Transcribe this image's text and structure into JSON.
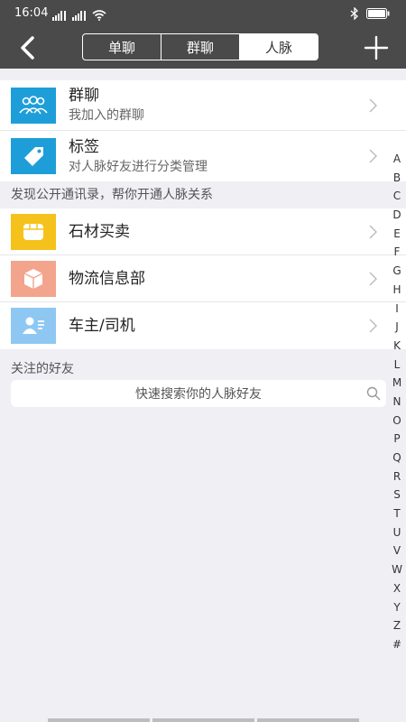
{
  "status_bar": {
    "time": "16:04",
    "signal_1": "4G",
    "signal_2": "4G"
  },
  "nav": {
    "tabs": [
      "单聊",
      "群聊",
      "人脉"
    ],
    "active_tab": "人脉"
  },
  "top_group": [
    {
      "title": "群聊",
      "subtitle": "我加入的群聊",
      "icon": "group-people-icon",
      "color": "#1e9ed8"
    },
    {
      "title": "标签",
      "subtitle": "对人脉好友进行分类管理",
      "icon": "tag-icon",
      "color": "#1e9ed8"
    }
  ],
  "discover": {
    "header": "发现公开通讯录，帮你开通人脉关系",
    "items": [
      {
        "title": "石材买卖",
        "icon": "stone-box-icon",
        "color": "#f5c21b"
      },
      {
        "title": "物流信息部",
        "icon": "cube-icon",
        "color": "#f3a48d"
      },
      {
        "title": "车主/司机",
        "icon": "driver-contact-icon",
        "color": "#8ec8f2"
      }
    ]
  },
  "friends": {
    "label": "关注的好友",
    "search_placeholder": "快速搜索你的人脉好友"
  },
  "index_letters": [
    "A",
    "B",
    "C",
    "D",
    "E",
    "F",
    "G",
    "H",
    "I",
    "J",
    "K",
    "L",
    "M",
    "N",
    "O",
    "P",
    "Q",
    "R",
    "S",
    "T",
    "U",
    "V",
    "W",
    "X",
    "Y",
    "Z",
    "#"
  ]
}
